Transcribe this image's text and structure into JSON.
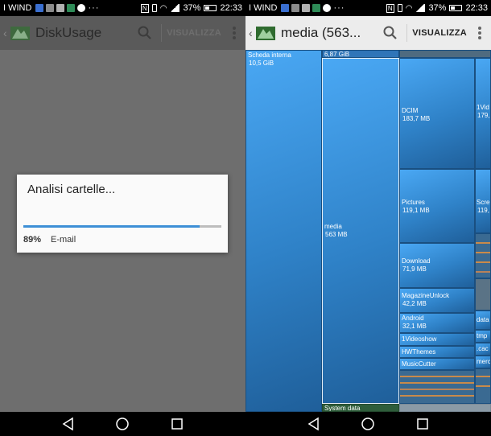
{
  "status_bar": {
    "carrier": "I WIND",
    "battery": "37%",
    "time": "22:33",
    "dots": "···"
  },
  "left": {
    "app_title": "DiskUsage",
    "view_label": "VISUALIZZA",
    "dialog": {
      "title": "Analisi cartelle...",
      "progress_fraction": 0.89,
      "percent_label": "89%",
      "current_path": "E-mail"
    }
  },
  "right": {
    "app_title": "media (563...",
    "view_label": "VISUALIZZA",
    "tiles": [
      {
        "name": "Scheda interna",
        "size": "10,5 GiB"
      },
      {
        "name": "",
        "size": "6,87 GiB"
      },
      {
        "name": "media",
        "size": "563 MB"
      },
      {
        "name": "DCIM",
        "size": "183,7 MB"
      },
      {
        "name": "Pictures",
        "size": "119,1 MB"
      },
      {
        "name": "Download",
        "size": "71,9 MB"
      },
      {
        "name": "MagazineUnlock",
        "size": "42,2 MB"
      },
      {
        "name": "Android",
        "size": "32,1 MB"
      },
      {
        "name": "1Videoshow",
        "size": ""
      },
      {
        "name": "HWThemes",
        "size": ""
      },
      {
        "name": "MusicCutter",
        "size": ""
      },
      {
        "name": "1Vid",
        "size": "179,"
      },
      {
        "name": "Scre",
        "size": "119,"
      },
      {
        "name": "data",
        "size": ""
      },
      {
        "name": "tmp",
        "size": ""
      },
      {
        "name": ".cac",
        "size": ""
      },
      {
        "name": "merc",
        "size": ""
      },
      {
        "name": "System data",
        "size": ""
      }
    ]
  },
  "colors": {
    "accent": "#3d8fd6",
    "tile_blue": "#2f82c8",
    "stripe_orange": "#c98a4a"
  }
}
